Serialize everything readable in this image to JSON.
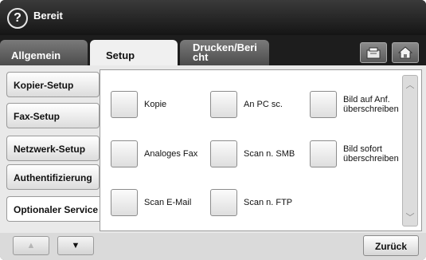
{
  "header": {
    "status": "Bereit",
    "help_icon": "?"
  },
  "tabs": [
    {
      "label": "Allgemein",
      "active": false
    },
    {
      "label": "Setup",
      "active": true
    },
    {
      "label": "Drucken/Bericht",
      "line1": "Drucken/Beri",
      "line2": "cht",
      "active": false
    }
  ],
  "toolbar_icons": [
    "job-status-icon",
    "home-icon"
  ],
  "sidebar": {
    "items": [
      {
        "label": "Kopier-Setup"
      },
      {
        "label": "Fax-Setup"
      },
      {
        "label": "Netzwerk-Setup"
      },
      {
        "label": "Authentifizierung"
      },
      {
        "label": "Optionaler Service",
        "selected": true
      }
    ],
    "page_up": "▲",
    "page_down": "▼"
  },
  "options": [
    {
      "label": "Kopie"
    },
    {
      "label": "An PC sc."
    },
    {
      "label": "Bild auf Anf. überschreiben",
      "line1": "Bild auf Anf.",
      "line2": "überschreiben"
    },
    {
      "label": "Analoges Fax"
    },
    {
      "label": "Scan n. SMB"
    },
    {
      "label": "Bild sofort überschreiben",
      "line1": "Bild sofort",
      "line2": "überschreiben"
    },
    {
      "label": "Scan E-Mail"
    },
    {
      "label": "Scan n. FTP"
    }
  ],
  "scrollbar": {
    "up": "︿",
    "down": "﹀"
  },
  "footer": {
    "back_label": "Zurück"
  },
  "colors": {
    "topbar": "#1d1d1d",
    "panel": "#e9e9e9",
    "tab_inactive": "#5c5c5c"
  }
}
